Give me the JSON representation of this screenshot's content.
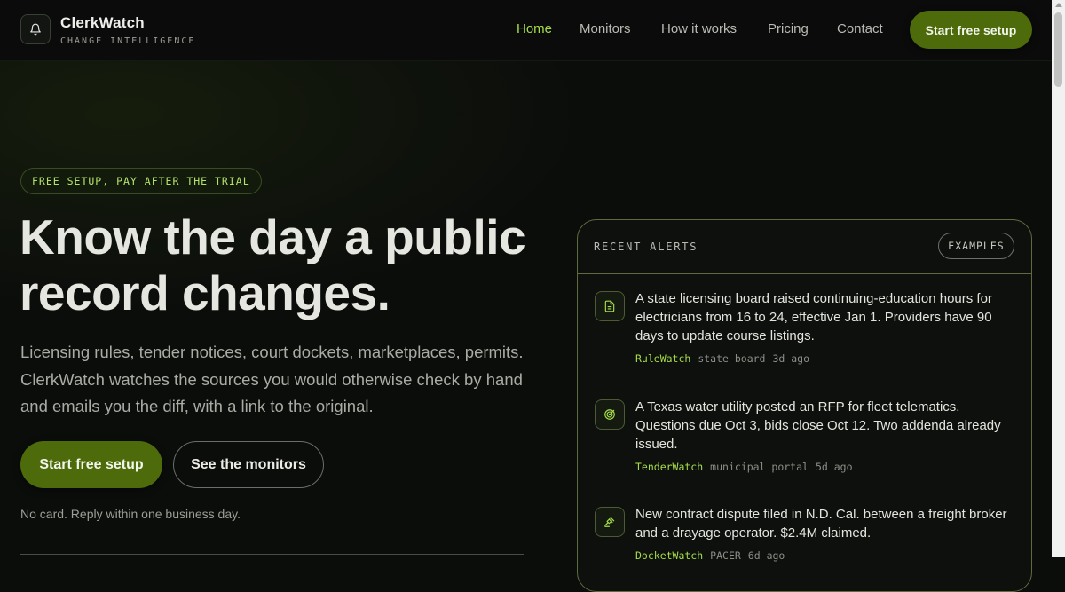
{
  "brand": {
    "name": "ClerkWatch",
    "tagline": "CHANGE INTELLIGENCE",
    "logo_icon": "bell-icon"
  },
  "nav": {
    "items": [
      {
        "label": "Home",
        "active": true
      },
      {
        "label": "Monitors",
        "active": false
      },
      {
        "label": "How it works",
        "active": false
      },
      {
        "label": "Pricing",
        "active": false
      },
      {
        "label": "Contact",
        "active": false
      }
    ],
    "cta_label": "Start free setup"
  },
  "hero": {
    "badge": "FREE SETUP, PAY AFTER THE TRIAL",
    "title": "Know the day a public record changes.",
    "subtitle": "Licensing rules, tender notices, court dockets, marketplaces, permits. ClerkWatch watches the sources you would otherwise check by hand and emails you the diff, with a link to the original.",
    "primary_cta": "Start free setup",
    "secondary_cta": "See the monitors",
    "fine_print": "No card. Reply within one business day."
  },
  "alerts_panel": {
    "title": "RECENT ALERTS",
    "pill": "EXAMPLES",
    "items": [
      {
        "icon": "document-icon",
        "text": "A state licensing board raised continuing-education hours for electricians from 16 to 24, effective Jan 1. Providers have 90 days to update course listings.",
        "tag": "RuleWatch",
        "source": "state board",
        "time": "3d ago"
      },
      {
        "icon": "target-icon",
        "text": "A Texas water utility posted an RFP for fleet telematics. Questions due Oct 3, bids close Oct 12. Two addenda already issued.",
        "tag": "TenderWatch",
        "source": "municipal portal",
        "time": "5d ago"
      },
      {
        "icon": "gavel-icon",
        "text": "New contract dispute filed in N.D. Cal. between a freight broker and a drayage operator. $2.4M claimed.",
        "tag": "DocketWatch",
        "source": "PACER",
        "time": "6d ago"
      }
    ]
  },
  "colors": {
    "background": "#0b0d0b",
    "accent": "#a6dd4a",
    "button": "#4e6b0c"
  }
}
